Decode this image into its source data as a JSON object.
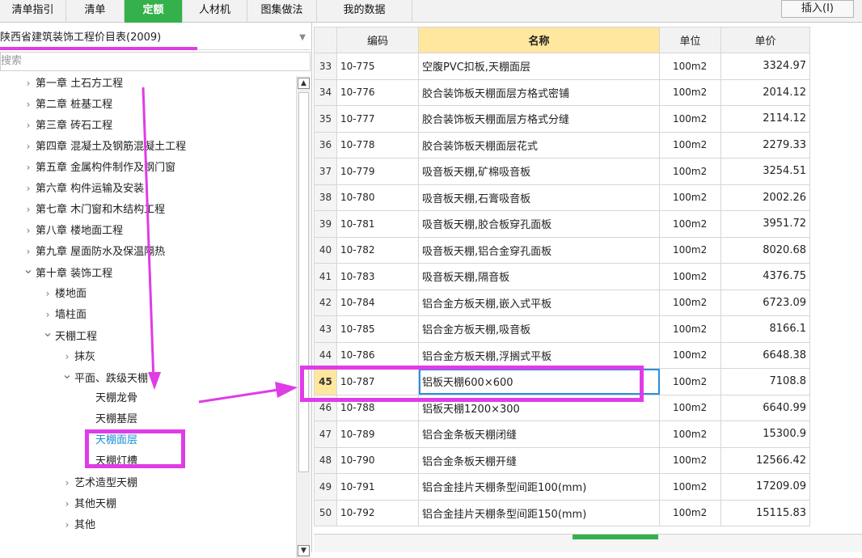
{
  "tabs": [
    {
      "label": "清单指引",
      "active": false
    },
    {
      "label": "清单",
      "active": false
    },
    {
      "label": "定额",
      "active": true
    },
    {
      "label": "人材机",
      "active": false
    },
    {
      "label": "图集做法",
      "active": false
    },
    {
      "label": "我的数据",
      "active": false
    }
  ],
  "insert_button": "插入(I)",
  "library": {
    "selected": "陕西省建筑装饰工程价目表(2009)"
  },
  "search": {
    "placeholder": "搜索"
  },
  "tree": [
    {
      "label": "第一章 土石方工程",
      "level": 1,
      "expanded": false
    },
    {
      "label": "第二章 桩基工程",
      "level": 1,
      "expanded": false
    },
    {
      "label": "第三章 砖石工程",
      "level": 1,
      "expanded": false
    },
    {
      "label": "第四章 混凝土及钢筋混凝土工程",
      "level": 1,
      "expanded": false
    },
    {
      "label": "第五章 金属构件制作及钢门窗",
      "level": 1,
      "expanded": false
    },
    {
      "label": "第六章 构件运输及安装",
      "level": 1,
      "expanded": false
    },
    {
      "label": "第七章 木门窗和木结构工程",
      "level": 1,
      "expanded": false
    },
    {
      "label": "第八章 楼地面工程",
      "level": 1,
      "expanded": false
    },
    {
      "label": "第九章 屋面防水及保温隔热",
      "level": 1,
      "expanded": false
    },
    {
      "label": "第十章 装饰工程",
      "level": 1,
      "expanded": true
    },
    {
      "label": "楼地面",
      "level": 2,
      "expanded": false
    },
    {
      "label": "墙柱面",
      "level": 2,
      "expanded": false
    },
    {
      "label": "天棚工程",
      "level": 2,
      "expanded": true
    },
    {
      "label": "抹灰",
      "level": 3,
      "expanded": false
    },
    {
      "label": "平面、跌级天棚",
      "level": 3,
      "expanded": true
    },
    {
      "label": "天棚龙骨",
      "level": 4,
      "leaf": true
    },
    {
      "label": "天棚基层",
      "level": 4,
      "leaf": true
    },
    {
      "label": "天棚面层",
      "level": 4,
      "leaf": true,
      "selected": true
    },
    {
      "label": "天棚灯槽",
      "level": 4,
      "leaf": true
    },
    {
      "label": "艺术造型天棚",
      "level": 3,
      "expanded": false
    },
    {
      "label": "其他天棚",
      "level": 3,
      "expanded": false
    },
    {
      "label": "其他",
      "level": 3,
      "expanded": false
    }
  ],
  "table": {
    "headers": [
      "",
      "编码",
      "名称",
      "单位",
      "单价"
    ],
    "active_row": 45,
    "rows": [
      {
        "num": "33",
        "code": "10-775",
        "name": "空腹PVC扣板,天棚面层",
        "unit": "100m2",
        "price": "3324.97"
      },
      {
        "num": "34",
        "code": "10-776",
        "name": "胶合装饰板天棚面层方格式密铺",
        "unit": "100m2",
        "price": "2014.12"
      },
      {
        "num": "35",
        "code": "10-777",
        "name": "胶合装饰板天棚面层方格式分缝",
        "unit": "100m2",
        "price": "2114.12"
      },
      {
        "num": "36",
        "code": "10-778",
        "name": "胶合装饰板天棚面层花式",
        "unit": "100m2",
        "price": "2279.33"
      },
      {
        "num": "37",
        "code": "10-779",
        "name": "吸音板天棚,矿棉吸音板",
        "unit": "100m2",
        "price": "3254.51"
      },
      {
        "num": "38",
        "code": "10-780",
        "name": "吸音板天棚,石膏吸音板",
        "unit": "100m2",
        "price": "2002.26"
      },
      {
        "num": "39",
        "code": "10-781",
        "name": "吸音板天棚,胶合板穿孔面板",
        "unit": "100m2",
        "price": "3951.72"
      },
      {
        "num": "40",
        "code": "10-782",
        "name": "吸音板天棚,铝合金穿孔面板",
        "unit": "100m2",
        "price": "8020.68"
      },
      {
        "num": "41",
        "code": "10-783",
        "name": "吸音板天棚,隔音板",
        "unit": "100m2",
        "price": "4376.75"
      },
      {
        "num": "42",
        "code": "10-784",
        "name": "铝合金方板天棚,嵌入式平板",
        "unit": "100m2",
        "price": "6723.09"
      },
      {
        "num": "43",
        "code": "10-785",
        "name": "铝合金方板天棚,吸音板",
        "unit": "100m2",
        "price": "8166.1"
      },
      {
        "num": "44",
        "code": "10-786",
        "name": "铝合金方板天棚,浮搁式平板",
        "unit": "100m2",
        "price": "6648.38"
      },
      {
        "num": "45",
        "code": "10-787",
        "name": "铝板天棚600×600",
        "unit": "100m2",
        "price": "7108.8"
      },
      {
        "num": "46",
        "code": "10-788",
        "name": "铝板天棚1200×300",
        "unit": "100m2",
        "price": "6640.99"
      },
      {
        "num": "47",
        "code": "10-789",
        "name": "铝合金条板天棚闭缝",
        "unit": "100m2",
        "price": "15300.9"
      },
      {
        "num": "48",
        "code": "10-790",
        "name": "铝合金条板天棚开缝",
        "unit": "100m2",
        "price": "12566.42"
      },
      {
        "num": "49",
        "code": "10-791",
        "name": "铝合金挂片天棚条型间距100(mm)",
        "unit": "100m2",
        "price": "17209.09"
      },
      {
        "num": "50",
        "code": "10-792",
        "name": "铝合金挂片天棚条型间距150(mm)",
        "unit": "100m2",
        "price": "15115.83"
      }
    ]
  },
  "colors": {
    "accent_green": "#34b14a",
    "highlight_yellow": "#ffe79e",
    "annotation": "#e03ce6"
  }
}
